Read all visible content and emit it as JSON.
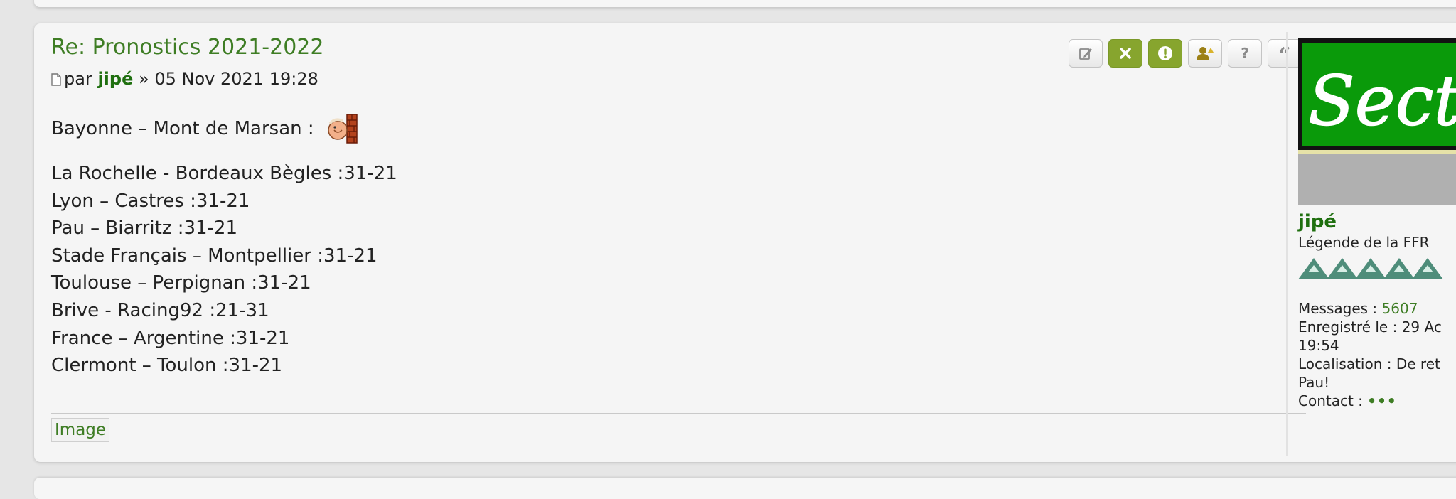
{
  "post": {
    "title": "Re: Pronostics 2021-2022",
    "by_label": "par",
    "author": "jipé",
    "separator": "»",
    "date": "05 Nov 2021 19:28",
    "buttons": [
      {
        "name": "edit",
        "icon": "edit-icon"
      },
      {
        "name": "delete",
        "icon": "close-icon"
      },
      {
        "name": "report",
        "icon": "warning-icon"
      },
      {
        "name": "warn-user",
        "icon": "user-warning-icon"
      },
      {
        "name": "information",
        "icon": "question-icon"
      },
      {
        "name": "quote",
        "icon": "quote-icon"
      }
    ],
    "content": {
      "first_line": "Bayonne – Mont de Marsan :",
      "smiley": "smiley-icon",
      "matches": [
        "La Rochelle - Bordeaux Bègles :31-21",
        "Lyon – Castres :31-21",
        "Pau – Biarritz :31-21",
        "Stade Français – Montpellier :31-21",
        "Toulouse – Perpignan :31-21",
        "Brive - Racing92 :21-31",
        "France – Argentine :31-21",
        "Clermont – Toulon :31-21"
      ]
    },
    "attachment_link": "Image"
  },
  "profile": {
    "avatar_text": "Sectio",
    "username": "jipé",
    "rank": "Légende de la FFR",
    "messages_label": "Messages :",
    "messages_count": "5607",
    "registered_label": "Enregistré le :",
    "registered_value": "29 Ac",
    "registered_time": "19:54",
    "location_label": "Localisation :",
    "location_value": "De ret",
    "location_value2": "Pau!",
    "contact_label": "Contact :",
    "contact_dots": "•••"
  },
  "colors": {
    "link_green": "#3e7d24",
    "username_green": "#1f6f0f",
    "button_green": "#87a52e",
    "chalkboard_green": "#0a9a0a"
  }
}
